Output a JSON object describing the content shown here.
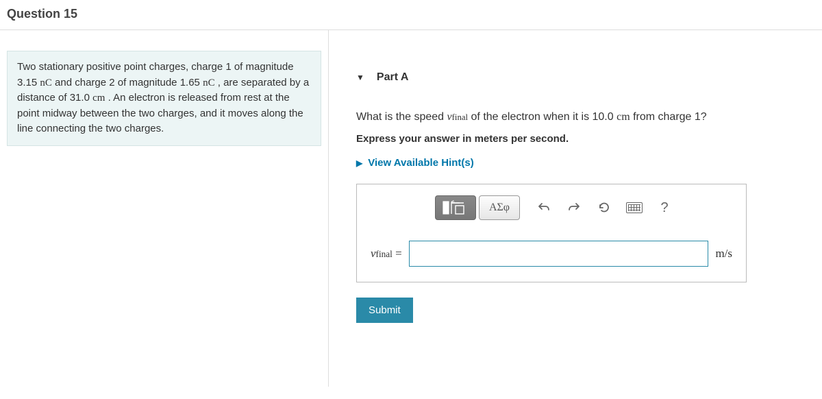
{
  "header": {
    "title": "Question 15"
  },
  "problem": {
    "text_pre": "Two stationary positive point charges, charge 1 of magnitude 3.15 ",
    "unit1": "nC",
    "text_mid1": " and charge 2 of magnitude 1.65 ",
    "unit2": "nC",
    "text_mid2": " , are separated by a distance of 31.0 ",
    "unit3": "cm",
    "text_post": " . An electron is released from rest at the point midway between the two charges, and it moves along the line connecting the two charges."
  },
  "part": {
    "label": "Part A"
  },
  "question": {
    "pre": "What is the speed ",
    "var": "v",
    "sub": "final",
    "mid": " of the electron when it is 10.0 ",
    "unit": "cm",
    "post": " from charge 1?"
  },
  "instruction": "Express your answer in meters per second.",
  "hints_label": "View Available Hint(s)",
  "toolbar": {
    "greek_label": "ΑΣφ",
    "help_label": "?"
  },
  "answer": {
    "lhs_var": "v",
    "lhs_sub": "final",
    "lhs_eq": " = ",
    "value": "",
    "unit": "m/s"
  },
  "submit_label": "Submit"
}
